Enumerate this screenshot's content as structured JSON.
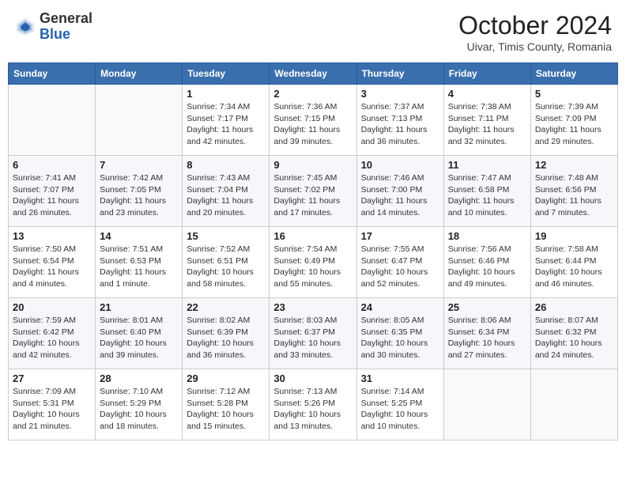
{
  "header": {
    "logo_general": "General",
    "logo_blue": "Blue",
    "month_title": "October 2024",
    "subtitle": "Uivar, Timis County, Romania"
  },
  "weekdays": [
    "Sunday",
    "Monday",
    "Tuesday",
    "Wednesday",
    "Thursday",
    "Friday",
    "Saturday"
  ],
  "weeks": [
    [
      {
        "day": "",
        "detail": ""
      },
      {
        "day": "",
        "detail": ""
      },
      {
        "day": "1",
        "detail": "Sunrise: 7:34 AM\nSunset: 7:17 PM\nDaylight: 11 hours and 42 minutes."
      },
      {
        "day": "2",
        "detail": "Sunrise: 7:36 AM\nSunset: 7:15 PM\nDaylight: 11 hours and 39 minutes."
      },
      {
        "day": "3",
        "detail": "Sunrise: 7:37 AM\nSunset: 7:13 PM\nDaylight: 11 hours and 36 minutes."
      },
      {
        "day": "4",
        "detail": "Sunrise: 7:38 AM\nSunset: 7:11 PM\nDaylight: 11 hours and 32 minutes."
      },
      {
        "day": "5",
        "detail": "Sunrise: 7:39 AM\nSunset: 7:09 PM\nDaylight: 11 hours and 29 minutes."
      }
    ],
    [
      {
        "day": "6",
        "detail": "Sunrise: 7:41 AM\nSunset: 7:07 PM\nDaylight: 11 hours and 26 minutes."
      },
      {
        "day": "7",
        "detail": "Sunrise: 7:42 AM\nSunset: 7:05 PM\nDaylight: 11 hours and 23 minutes."
      },
      {
        "day": "8",
        "detail": "Sunrise: 7:43 AM\nSunset: 7:04 PM\nDaylight: 11 hours and 20 minutes."
      },
      {
        "day": "9",
        "detail": "Sunrise: 7:45 AM\nSunset: 7:02 PM\nDaylight: 11 hours and 17 minutes."
      },
      {
        "day": "10",
        "detail": "Sunrise: 7:46 AM\nSunset: 7:00 PM\nDaylight: 11 hours and 14 minutes."
      },
      {
        "day": "11",
        "detail": "Sunrise: 7:47 AM\nSunset: 6:58 PM\nDaylight: 11 hours and 10 minutes."
      },
      {
        "day": "12",
        "detail": "Sunrise: 7:48 AM\nSunset: 6:56 PM\nDaylight: 11 hours and 7 minutes."
      }
    ],
    [
      {
        "day": "13",
        "detail": "Sunrise: 7:50 AM\nSunset: 6:54 PM\nDaylight: 11 hours and 4 minutes."
      },
      {
        "day": "14",
        "detail": "Sunrise: 7:51 AM\nSunset: 6:53 PM\nDaylight: 11 hours and 1 minute."
      },
      {
        "day": "15",
        "detail": "Sunrise: 7:52 AM\nSunset: 6:51 PM\nDaylight: 10 hours and 58 minutes."
      },
      {
        "day": "16",
        "detail": "Sunrise: 7:54 AM\nSunset: 6:49 PM\nDaylight: 10 hours and 55 minutes."
      },
      {
        "day": "17",
        "detail": "Sunrise: 7:55 AM\nSunset: 6:47 PM\nDaylight: 10 hours and 52 minutes."
      },
      {
        "day": "18",
        "detail": "Sunrise: 7:56 AM\nSunset: 6:46 PM\nDaylight: 10 hours and 49 minutes."
      },
      {
        "day": "19",
        "detail": "Sunrise: 7:58 AM\nSunset: 6:44 PM\nDaylight: 10 hours and 46 minutes."
      }
    ],
    [
      {
        "day": "20",
        "detail": "Sunrise: 7:59 AM\nSunset: 6:42 PM\nDaylight: 10 hours and 42 minutes."
      },
      {
        "day": "21",
        "detail": "Sunrise: 8:01 AM\nSunset: 6:40 PM\nDaylight: 10 hours and 39 minutes."
      },
      {
        "day": "22",
        "detail": "Sunrise: 8:02 AM\nSunset: 6:39 PM\nDaylight: 10 hours and 36 minutes."
      },
      {
        "day": "23",
        "detail": "Sunrise: 8:03 AM\nSunset: 6:37 PM\nDaylight: 10 hours and 33 minutes."
      },
      {
        "day": "24",
        "detail": "Sunrise: 8:05 AM\nSunset: 6:35 PM\nDaylight: 10 hours and 30 minutes."
      },
      {
        "day": "25",
        "detail": "Sunrise: 8:06 AM\nSunset: 6:34 PM\nDaylight: 10 hours and 27 minutes."
      },
      {
        "day": "26",
        "detail": "Sunrise: 8:07 AM\nSunset: 6:32 PM\nDaylight: 10 hours and 24 minutes."
      }
    ],
    [
      {
        "day": "27",
        "detail": "Sunrise: 7:09 AM\nSunset: 5:31 PM\nDaylight: 10 hours and 21 minutes."
      },
      {
        "day": "28",
        "detail": "Sunrise: 7:10 AM\nSunset: 5:29 PM\nDaylight: 10 hours and 18 minutes."
      },
      {
        "day": "29",
        "detail": "Sunrise: 7:12 AM\nSunset: 5:28 PM\nDaylight: 10 hours and 15 minutes."
      },
      {
        "day": "30",
        "detail": "Sunrise: 7:13 AM\nSunset: 5:26 PM\nDaylight: 10 hours and 13 minutes."
      },
      {
        "day": "31",
        "detail": "Sunrise: 7:14 AM\nSunset: 5:25 PM\nDaylight: 10 hours and 10 minutes."
      },
      {
        "day": "",
        "detail": ""
      },
      {
        "day": "",
        "detail": ""
      }
    ]
  ]
}
